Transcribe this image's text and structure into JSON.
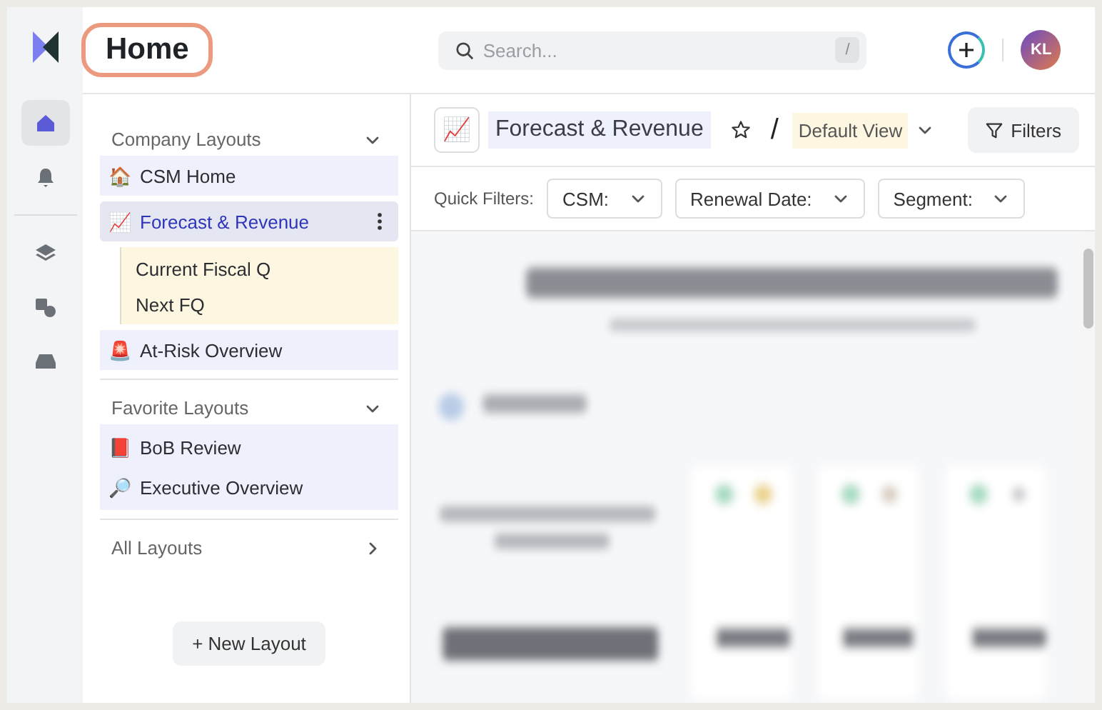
{
  "header": {
    "title": "Home",
    "search": {
      "placeholder": "Search...",
      "shortcut": "/"
    },
    "avatar": "KL"
  },
  "rail": [
    {
      "kind": "home",
      "selected": true
    },
    {
      "kind": "bell",
      "selected": false
    },
    {
      "kind": "layers",
      "selected": false
    },
    {
      "kind": "shapes",
      "selected": false
    },
    {
      "kind": "inbox",
      "selected": false
    }
  ],
  "sidebar": {
    "sections": [
      {
        "title": "Company Layouts",
        "expanded": true,
        "items": [
          {
            "icon": "🏠",
            "label": "CSM Home",
            "selected": false
          },
          {
            "icon": "📈",
            "label": "Forecast & Revenue",
            "selected": true,
            "children": [
              {
                "label": "Current Fiscal Q"
              },
              {
                "label": "Next FQ"
              }
            ]
          },
          {
            "icon": "🚨",
            "label": "At-Risk Overview",
            "selected": false
          }
        ]
      },
      {
        "title": "Favorite Layouts",
        "expanded": true,
        "items": [
          {
            "icon": "📕",
            "label": "BoB Review",
            "selected": false
          },
          {
            "icon": "🔎",
            "label": "Executive Overview",
            "selected": false
          }
        ]
      },
      {
        "title": "All Layouts",
        "expanded": false
      }
    ],
    "new_button": "+ New Layout"
  },
  "main": {
    "icon": "📈",
    "title": "Forecast & Revenue",
    "separator": "/",
    "view": "Default View",
    "filters_button": "Filters",
    "quick_filters": {
      "label": "Quick Filters:",
      "items": [
        "CSM:",
        "Renewal Date:",
        "Segment:"
      ]
    }
  }
}
